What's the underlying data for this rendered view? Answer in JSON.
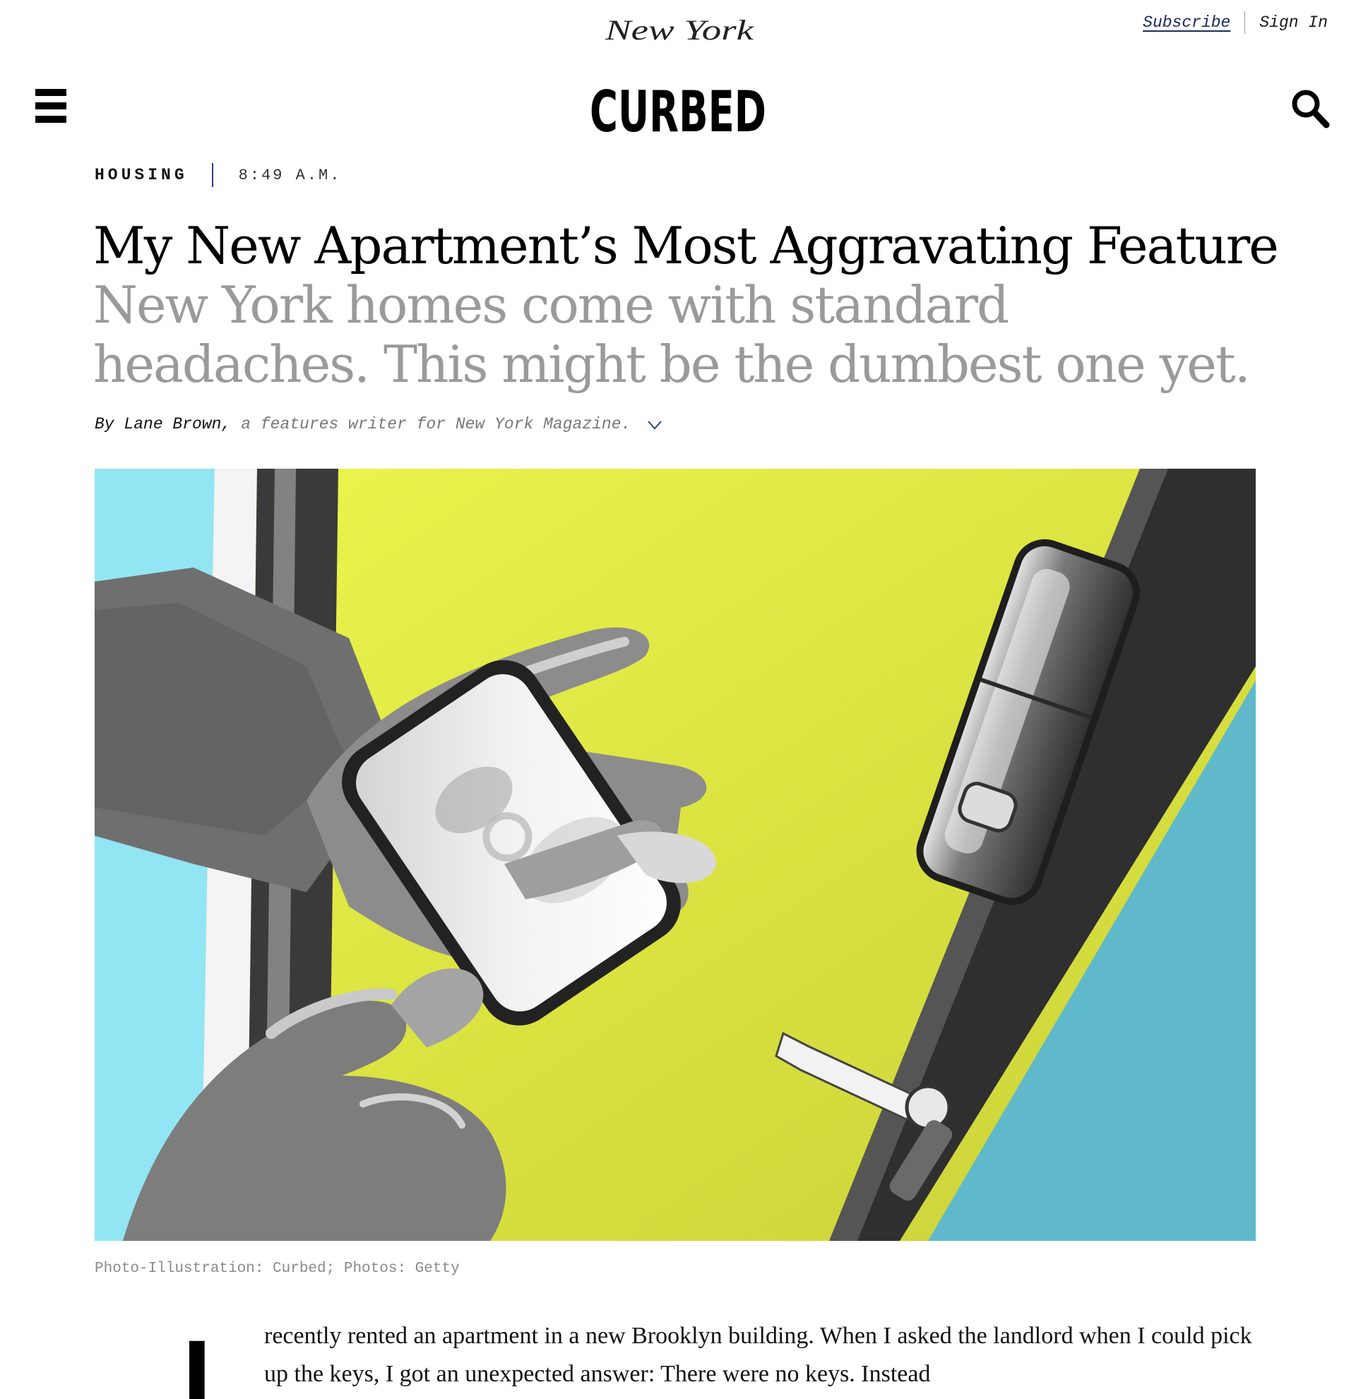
{
  "masthead": {
    "parent_brand": "New York",
    "site_brand": "CURBED",
    "subscribe_label": "Subscribe",
    "sign_in_label": "Sign In"
  },
  "article": {
    "section": "HOUSING",
    "time": "8:49 A.M.",
    "headline": "My New Apartment’s Most Aggravating Feature",
    "dek": "New York homes come with standard headaches. This might be the dumbest one yet.",
    "byline_author": "By Lane Brown,",
    "byline_bio": "a features writer for New York Magazine.",
    "image_credit": "Photo-Illustration: Curbed; Photos: Getty",
    "drop_cap": "I",
    "body_text": "recently rented an apartment in a new Brooklyn building. When I asked the landlord when I could pick up the keys, I got an unexpected answer: There were no keys. Instead"
  },
  "icons": {
    "menu": "menu-icon",
    "search": "search-icon",
    "byline_toggle": "chevron-down-icon"
  },
  "colors": {
    "accent_blue": "#2b3f8a",
    "dek_gray": "#9a9a9a",
    "image_yellow": "#e4ec45",
    "image_cyan": "#8fe4f2",
    "image_teal": "#5fb9cb"
  }
}
